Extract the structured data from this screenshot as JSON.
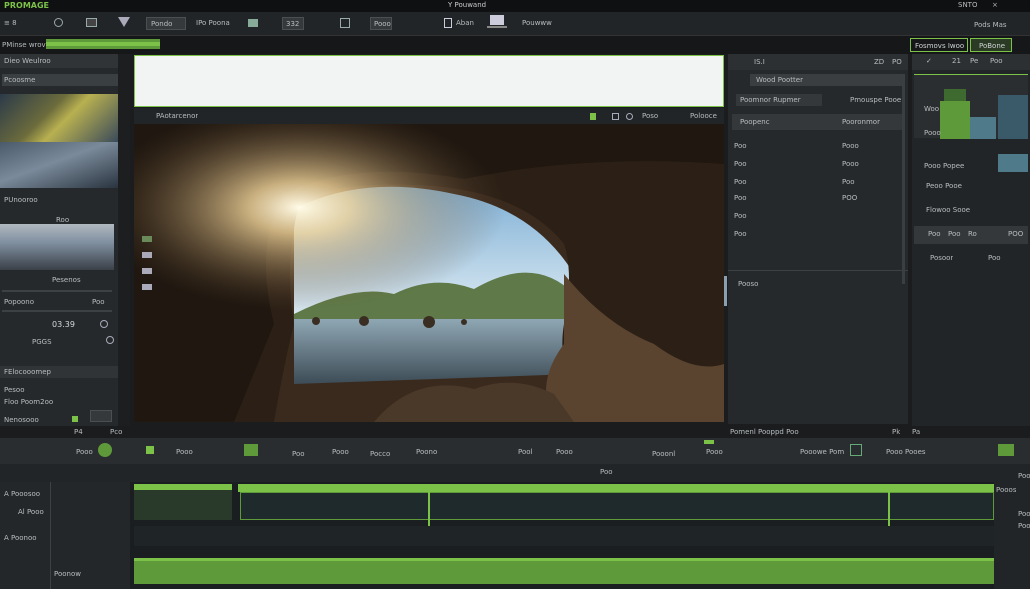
{
  "app": {
    "name": "PROMAGE",
    "window_title": "Y Pouwand",
    "top_right_a": "SNTO",
    "top_right_b": "×"
  },
  "toolbar": {
    "items": [
      "≡ 8",
      "Pondo",
      "IPo Poona",
      "332",
      "Pooo",
      "Aban",
      "Pouwww"
    ],
    "right_label": "Pods Mas"
  },
  "subbar": {
    "left_label": "PMinse wrove",
    "btn_export": "Fosmovs Iwoo",
    "btn_publish": "PoBone"
  },
  "left_panel": {
    "header": "Dieo Weulroo",
    "tab": "Pcoosme",
    "section2_title": "PUnooroo",
    "section2_value": "Roo",
    "thumb2_caption": "Pesenos",
    "row_label_a": "Popoono",
    "row_label_b": "Poo",
    "timecode": "03.39",
    "value_a": "PGGS",
    "section3_title": "FElocooomep",
    "section3_row": "Pesoo",
    "section3_row2": "Floo Poom2oo",
    "section3_row3": "Nenosooo",
    "bottom_tab": "Poo"
  },
  "viewer": {
    "label": "PAotarcenor",
    "right_a": "Poso",
    "right_b": "Polooce"
  },
  "right_panel": {
    "header_a": "IS.I",
    "header_b": "ZD",
    "header_c": "PO",
    "search_label": "Wood Pootter",
    "filter_label": "Poomnor Rupmer",
    "filter_right": "Pmouspe Pooe",
    "col_a": "Poopenc",
    "col_b": "Pooronmor",
    "rows": [
      {
        "a": "Poo",
        "b": "Pooo"
      },
      {
        "a": "Poo",
        "b": "Pooo"
      },
      {
        "a": "Poo",
        "b": "Poo"
      },
      {
        "a": "Poo",
        "b": "POO"
      },
      {
        "a": "Poo",
        "b": ""
      },
      {
        "a": "Poo",
        "b": ""
      }
    ],
    "footer_label": "Pooso"
  },
  "far_right": {
    "tabs": [
      "✓",
      "21",
      "Pe",
      "Poo"
    ],
    "hist_label_a": "Woo",
    "hist_label_b": "Pooo",
    "row_a": "Pooo Popee",
    "row_b": "Peoo Pooe",
    "row_c": "Flowoo Sooe",
    "cells": [
      "Poo",
      "Poo",
      "Ro",
      "POO"
    ],
    "bottom_a": "Posoor",
    "bottom_b": "Poo"
  },
  "timeline": {
    "header_label": "Pco",
    "header_right": "Pomenl Pooppd Poo",
    "header_right_b": "Pk",
    "header_right_c": "Pa",
    "track_labels": [
      "Pooo",
      "Pooo",
      "Poo",
      "Pooo",
      "Pocco",
      "Poono",
      "Pool",
      "Pooo",
      "Pooonl",
      "Pooo",
      "Pooowe Pom",
      "Pooo Pooes"
    ],
    "ruler_label": "Poo",
    "left_labels": [
      "A Pooosoo",
      "Al Pooo",
      "A Poonoo",
      "Poonow"
    ],
    "right_labels": [
      "Pooos",
      "Poo",
      "Poo",
      "Poo"
    ],
    "corner": "P4"
  },
  "colors": {
    "accent_green": "#7cc249",
    "panel_dark": "#1e2022"
  }
}
